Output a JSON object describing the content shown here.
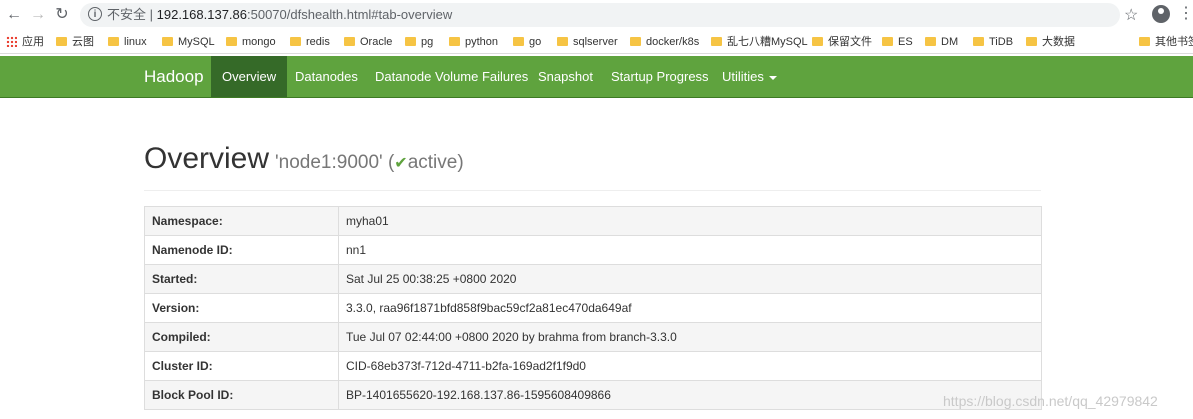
{
  "browser": {
    "security_label": "不安全",
    "url_host": "192.168.137.86",
    "url_rest": ":50070/dfshealth.html#tab-overview"
  },
  "bookmarks": {
    "apps": "应用",
    "items": [
      "云图",
      "linux",
      "MySQL",
      "mongo",
      "redis",
      "Oracle",
      "pg",
      "python",
      "go",
      "sqlserver",
      "docker/k8s",
      "乱七八糟MySQL",
      "保留文件",
      "ES",
      "DM",
      "TiDB",
      "大数据"
    ],
    "other": "其他书签"
  },
  "navbar": {
    "brand": "Hadoop",
    "items": [
      "Overview",
      "Datanodes",
      "Datanode Volume Failures",
      "Snapshot",
      "Startup Progress",
      "Utilities"
    ],
    "active": "Overview",
    "accent_color": "#5fa33e"
  },
  "header": {
    "title": "Overview",
    "node": "'node1:9000'",
    "status_open": "(",
    "status": "active",
    "status_close": ")"
  },
  "info_table": [
    {
      "key": "Namespace:",
      "value": "myha01"
    },
    {
      "key": "Namenode ID:",
      "value": "nn1"
    },
    {
      "key": "Started:",
      "value": "Sat Jul 25 00:38:25 +0800 2020"
    },
    {
      "key": "Version:",
      "value": "3.3.0, raa96f1871bfd858f9bac59cf2a81ec470da649af"
    },
    {
      "key": "Compiled:",
      "value": "Tue Jul 07 02:44:00 +0800 2020 by brahma from branch-3.3.0"
    },
    {
      "key": "Cluster ID:",
      "value": "CID-68eb373f-712d-4711-b2fa-169ad2f1f9d0"
    },
    {
      "key": "Block Pool ID:",
      "value": "BP-1401655620-192.168.137.86-1595608409866"
    }
  ],
  "watermark": "https://blog.csdn.net/qq_42979842"
}
